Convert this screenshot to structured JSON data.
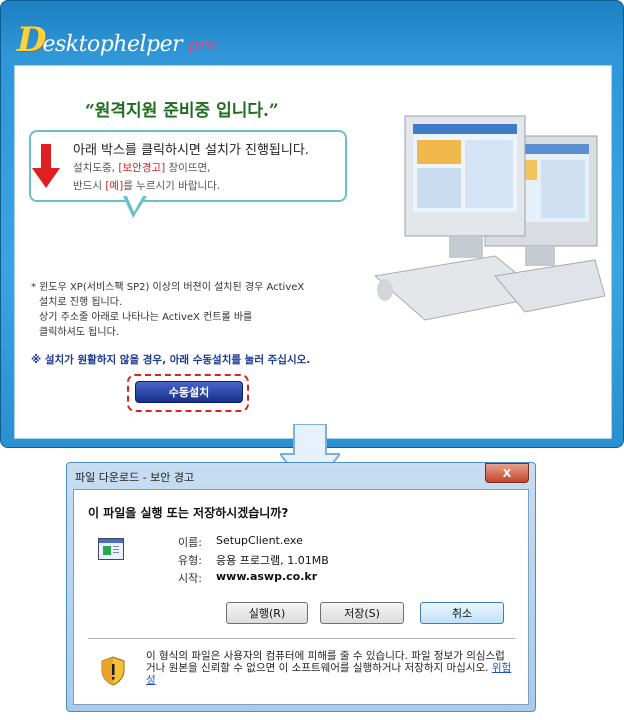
{
  "main_window": {
    "logo": {
      "initial": "D",
      "rest": "esktophelper",
      "suffix": "pro"
    },
    "title": "“원격지원 준비중 입니다.”",
    "bubble": {
      "line1": "아래 박스를 클릭하시면 설치가 진행됩니다.",
      "line2_pre": "설치도중, ",
      "line2_red": "[보안경고]",
      "line2_post": " 창이뜨면,",
      "line3_pre": "반드시 ",
      "line3_red": "[예]",
      "line3_post": "를 누르시기 바랍니다."
    },
    "note_lines": [
      "* 윈도우 XP(서비스팩 SP2) 이상의 버젼이 설치된 경우 ActiveX",
      "  설치로 진행 됩니다.",
      "  상기 주소줄 아래로 나타나는 ActiveX 컨트롤 바를",
      "  클릭하셔도 됩니다."
    ],
    "notice": "※ 설치가 원활하지 않을 경우, 아래 수동설치를 눌러 주십시오.",
    "manual_install_button": "수동설치"
  },
  "dialog": {
    "title": "파일 다운로드 - 보안 경고",
    "close_label": "X",
    "question": "이 파일을 실행 또는 저장하시겠습니까?",
    "fields": [
      {
        "label": "이름:",
        "value": "SetupClient.exe"
      },
      {
        "label": "유형:",
        "value": "응용 프로그램, 1.01MB"
      },
      {
        "label": "시작:",
        "value": "www.aswp.co.kr"
      }
    ],
    "buttons": {
      "run": "실행(R)",
      "save": "저장(S)",
      "cancel": "취소"
    },
    "warning_text": "이 형식의 파일은 사용자의 컴퓨터에 피해를 줄 수 있습니다. 파일 정보가 의심스럽거나 원본을 신뢰할 수 없으면 이 소프트웨어를 실행하거나 저장하지 마십시오. ",
    "warning_link": "위험성"
  },
  "colors": {
    "accent_blue": "#2f97d8",
    "alert_red": "#e02020",
    "title_green": "#1c6e1c"
  }
}
